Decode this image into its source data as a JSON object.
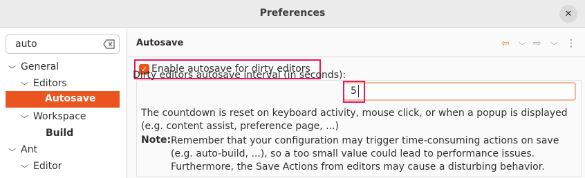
{
  "window": {
    "title": "Preferences"
  },
  "search": {
    "value": "auto"
  },
  "tree": {
    "general": "General",
    "editors": "Editors",
    "autosave": "Autosave",
    "workspace": "Workspace",
    "build": "Build",
    "ant": "Ant",
    "editor": "Editor"
  },
  "page": {
    "title": "Autosave",
    "checkbox_label": "Enable autosave for dirty editors",
    "checkbox_checked": true,
    "interval_label": "Dirty editors autosave interval (in seconds):",
    "interval_value": "5",
    "description": "The countdown is reset on keyboard activity, mouse click, or when a popup is displayed (e.g. content assist, preference page, ...)",
    "note_label": "Note:",
    "note_text": "Remember that your configuration may trigger time-consuming actions on save (e.g. auto-build, ...), so a too small value could lead to performance issues. Furthermore, the Save Actions from editors may cause a disturbing behavior."
  },
  "colors": {
    "accent": "#e9541f",
    "highlight": "#e6195f"
  }
}
